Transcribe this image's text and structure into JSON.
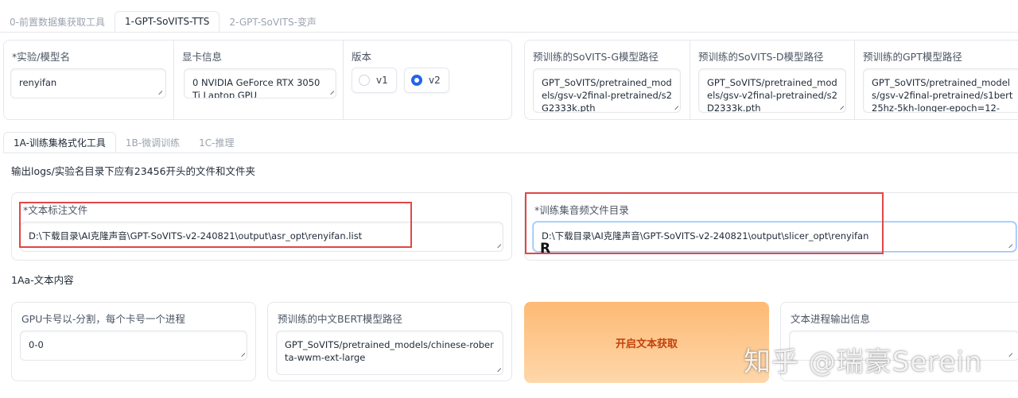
{
  "top_tabs": [
    {
      "label": "0-前置数据集获取工具"
    },
    {
      "label": "1-GPT-SoVITS-TTS"
    },
    {
      "label": "2-GPT-SoVITS-变声"
    }
  ],
  "config": {
    "exp_label": "*实验/模型名",
    "exp_value": "renyifan",
    "gpu_label": "显卡信息",
    "gpu_value": "0 NVIDIA GeForce RTX 3050 Ti Laptop GPU",
    "version_label": "版本",
    "version_options": [
      {
        "label": "v1",
        "checked": false
      },
      {
        "label": "v2",
        "checked": true
      }
    ],
    "sovits_g_label": "预训练的SoVITS-G模型路径",
    "sovits_g_value": "GPT_SoVITS/pretrained_models/gsv-v2final-pretrained/s2G2333k.pth",
    "sovits_d_label": "预训练的SoVITS-D模型路径",
    "sovits_d_value": "GPT_SoVITS/pretrained_models/gsv-v2final-pretrained/s2D2333k.pth",
    "gpt_label": "预训练的GPT模型路径",
    "gpt_value": "GPT_SoVITS/pretrained_models/gsv-v2final-pretrained/s1bert25hz-5kh-longer-epoch=12-"
  },
  "sub_tabs": [
    {
      "label": "1A-训练集格式化工具"
    },
    {
      "label": "1B-微调训练"
    },
    {
      "label": "1C-推理"
    }
  ],
  "format_tool": {
    "hint": "输出logs/实验名目录下应有23456开头的文件和文件夹",
    "text_file_label": "*文本标注文件",
    "text_file_value": "D:\\下载目录\\AI克隆声音\\GPT-SoVITS-v2-240821\\output\\asr_opt\\renyifan.list",
    "audio_dir_label": "*训练集音频文件目录",
    "audio_dir_value": "D:\\下载目录\\AI克隆声音\\GPT-SoVITS-v2-240821\\output\\slicer_opt\\renyifan",
    "section_title": "1Aa-文本内容",
    "gpu_split_label": "GPU卡号以-分割，每个卡号一个进程",
    "gpu_split_value": "0-0",
    "bert_label": "预训练的中文BERT模型路径",
    "bert_value": "GPT_SoVITS/pretrained_models/chinese-roberta-wwm-ext-large",
    "start_button": "开启文本获取",
    "output_label": "文本进程输出信息"
  },
  "watermark": "知乎 @瑞豪Serein",
  "colors": {
    "accent": "#2563eb",
    "highlight_box": "#e04747",
    "button_orange": "#fdba74"
  }
}
